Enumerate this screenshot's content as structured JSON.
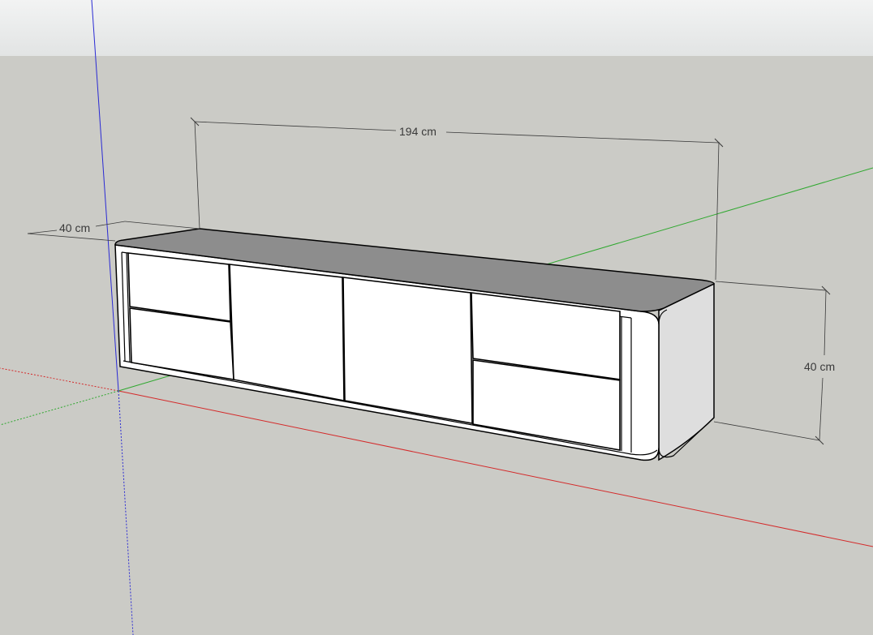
{
  "viewport": {
    "sky_color": "#e8eaea",
    "ground_color": "#cbcbc6"
  },
  "axes": {
    "red_color": "#d42a2a",
    "green_color": "#2fa82f",
    "blue_color": "#2a2ad4"
  },
  "model": {
    "top_color": "#8d8d8d",
    "front_color": "#ffffff",
    "side_color": "#dedede",
    "edge_color": "#000000"
  },
  "dimensions": {
    "width_label": "194 cm",
    "depth_label": "40 cm",
    "height_label": "40 cm",
    "line_color": "#3a3a3a"
  }
}
